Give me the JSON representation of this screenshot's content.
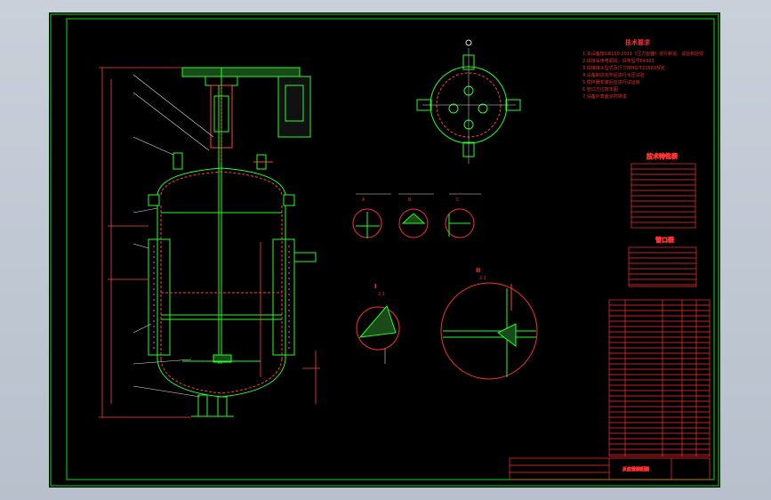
{
  "drawing": {
    "frame_color": "#00c000",
    "line_color": "#22ff22",
    "text_color": "#ff2a2a",
    "background": "#000000",
    "viewport_background": "#c3cad4"
  },
  "notes": {
    "title": "技术要求",
    "lines": [
      "1.本设备按GB150-2011《压力容器》进行制造、试验和验收",
      "2.焊接采用电弧焊，焊条型号E4303",
      "3.焊接接头型式及尺寸按HG/T20583规定",
      "4.设备制造完毕后进行水压试验",
      "5.搅拌器安装后应进行试运转",
      "6.管口方位按本图",
      "7.设备外表面涂防锈漆"
    ]
  },
  "spec_table": {
    "title": "技术特性表"
  },
  "nozzle_table": {
    "title": "管口表"
  },
  "sections": {
    "view_i": "I",
    "view_ii": "II",
    "scale_i": "2:1",
    "scale_ii": "2:1",
    "detail_a": "A",
    "detail_b": "B",
    "detail_c": "C"
  },
  "title_block": {
    "name": "反应釜装配图"
  }
}
